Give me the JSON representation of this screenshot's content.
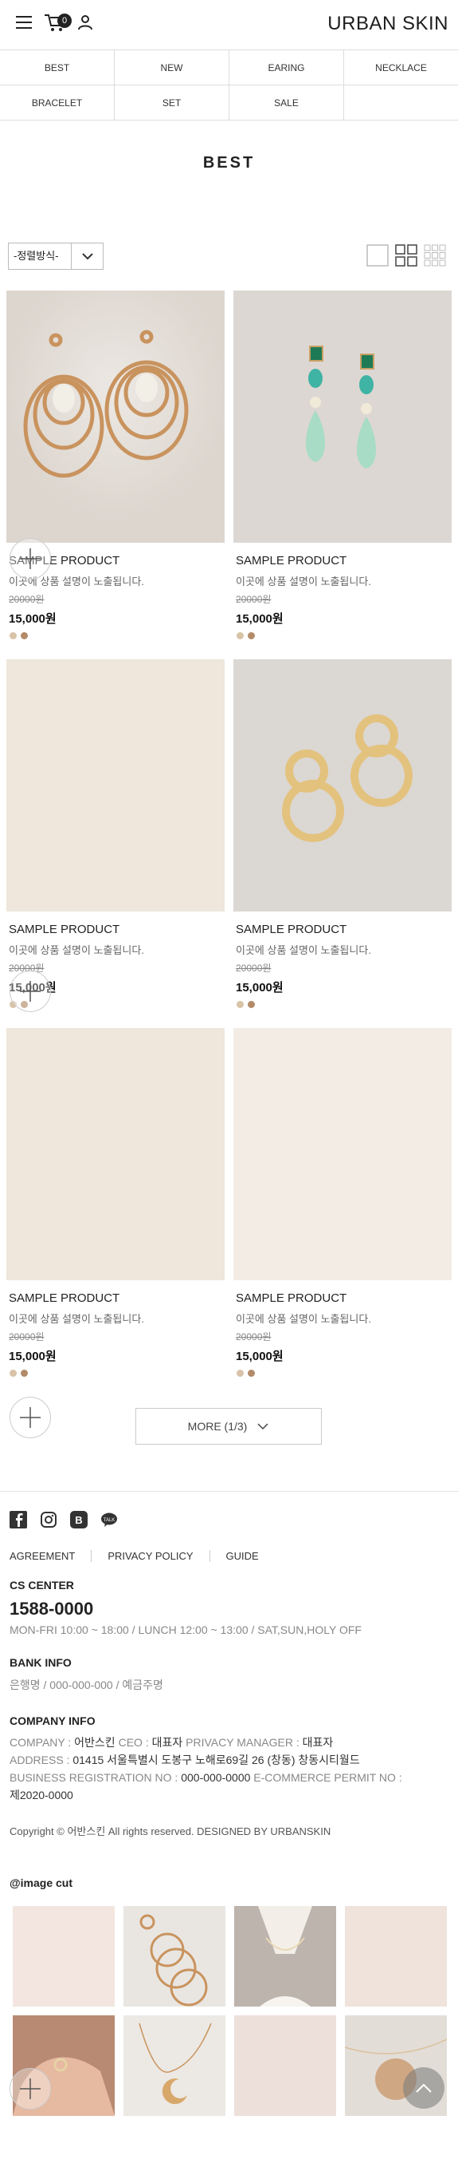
{
  "header": {
    "logo": "URBAN SKIN",
    "cart_count": "0",
    "icons": [
      "menu-icon",
      "cart-icon",
      "user-icon"
    ]
  },
  "nav": {
    "row1": [
      "BEST",
      "NEW",
      "EARING",
      "NECKLACE"
    ],
    "row2": [
      "BRACELET",
      "SET",
      "SALE",
      ""
    ]
  },
  "page_title": "BEST",
  "sort": {
    "label": "-정렬방식-"
  },
  "products": [
    {
      "name": "SAMPLE PRODUCT",
      "desc": "이곳에 상품 설명이 노출됩니다.",
      "old_price": "20000원",
      "price": "15,000원"
    },
    {
      "name": "SAMPLE PRODUCT",
      "desc": "이곳에 상품 설명이 노출됩니다.",
      "old_price": "20000원",
      "price": "15,000원"
    },
    {
      "name": "SAMPLE PRODUCT",
      "desc": "이곳에 상품 설명이 노출됩니다.",
      "old_price": "20000원",
      "price": "15,000원"
    },
    {
      "name": "SAMPLE PRODUCT",
      "desc": "이곳에 상품 설명이 노출됩니다.",
      "old_price": "20000원",
      "price": "15,000원"
    },
    {
      "name": "SAMPLE PRODUCT",
      "desc": "이곳에 상품 설명이 노출됩니다.",
      "old_price": "20000원",
      "price": "15,000원"
    },
    {
      "name": "SAMPLE PRODUCT",
      "desc": "이곳에 상품 설명이 노출됩니다.",
      "old_price": "20000원",
      "price": "15,000원"
    }
  ],
  "swatch_colors": [
    "#d9c3a8",
    "#b38b68"
  ],
  "more": {
    "label": "MORE (1/3)"
  },
  "footer": {
    "social_icons": [
      "facebook-icon",
      "instagram-icon",
      "blog-icon",
      "kakao-icon"
    ],
    "links": [
      "AGREEMENT",
      "PRIVACY POLICY",
      "GUIDE"
    ],
    "cs_title": "CS CENTER",
    "phone": "1588-0000",
    "hours": "MON-FRI 10:00 ~ 18:00 / LUNCH 12:00 ~ 13:00 / SAT,SUN,HOLY OFF",
    "bank_title": "BANK INFO",
    "bank": "은행명 / 000-000-000 / 예금주명",
    "company_title": "COMPANY INFO",
    "company_line1_label": "COMPANY : ",
    "company_name": "어반스킨",
    "ceo_label": " CEO : ",
    "ceo": "대표자",
    "privacy_label": " PRIVACY MANAGER : ",
    "privacy": "대표자",
    "address_label": "ADDRESS : ",
    "address": "01415 서울특별시 도봉구 노해로69길 26 (창동) 창동시티월드",
    "biz_label": "BUSINESS REGISTRATION NO : ",
    "biz": "000-000-0000",
    "ecom_label": " E-COMMERCE PERMIT NO : ",
    "ecom": "제2020-0000",
    "copyright": "Copyright © 어반스킨 All rights reserved. DESIGNED BY URBANSKIN"
  },
  "insta_title": "@image cut",
  "colors": {
    "accent": "#222222",
    "muted": "#888888",
    "beige": "#efe6dc"
  }
}
